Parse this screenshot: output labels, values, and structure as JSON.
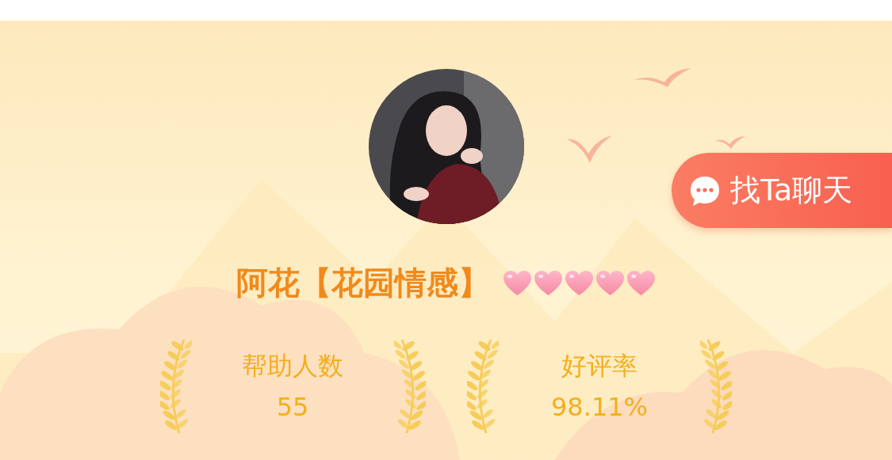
{
  "profile": {
    "name": "阿花【花园情感】",
    "stars": 5
  },
  "chat_button": {
    "label": "找Ta聊天"
  },
  "stats": [
    {
      "label": "帮助人数",
      "value": "55"
    },
    {
      "label": "好评率",
      "value": "98.11%"
    }
  ]
}
